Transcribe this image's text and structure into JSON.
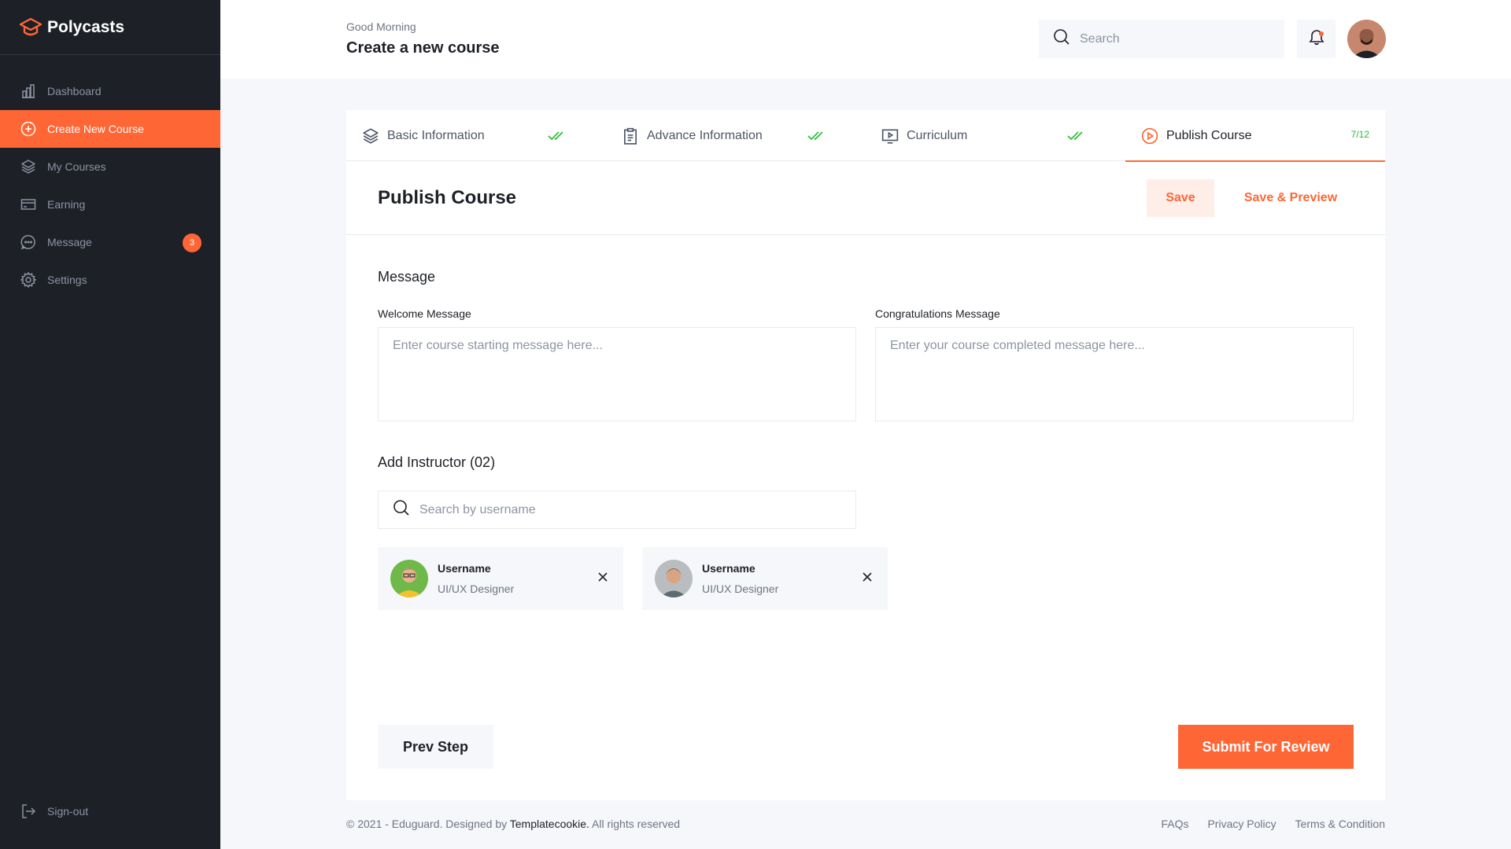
{
  "brand": {
    "name": "Polycasts",
    "accent": "#FF6636",
    "sidebar_bg": "#1D2026"
  },
  "sidebar": {
    "items": [
      {
        "label": "Dashboard",
        "icon": "bar-chart-icon"
      },
      {
        "label": "Create New Course",
        "icon": "plus-circle-icon",
        "active": true
      },
      {
        "label": "My Courses",
        "icon": "stack-icon"
      },
      {
        "label": "Earning",
        "icon": "credit-card-icon"
      },
      {
        "label": "Message",
        "icon": "chat-icon",
        "badge": "3"
      },
      {
        "label": "Settings",
        "icon": "gear-icon"
      }
    ],
    "signout": "Sign-out"
  },
  "header": {
    "greeting": "Good Morning",
    "title": "Create a new course",
    "search_placeholder": "Search"
  },
  "tabs": [
    {
      "label": "Basic Information",
      "icon": "stack-icon",
      "status": "done"
    },
    {
      "label": "Advance Information",
      "icon": "clipboard-icon",
      "status": "done"
    },
    {
      "label": "Curriculum",
      "icon": "monitor-play-icon",
      "status": "done"
    },
    {
      "label": "Publish Course",
      "icon": "play-circle-icon",
      "progress": "7/12",
      "active": true
    }
  ],
  "section": {
    "title": "Publish Course",
    "save": "Save",
    "save_preview": "Save & Preview"
  },
  "message": {
    "title": "Message",
    "welcome_label": "Welcome Message",
    "welcome_placeholder": "Enter course starting message here...",
    "congrats_label": "Congratulations Message",
    "congrats_placeholder": "Enter your course completed message here..."
  },
  "instructors": {
    "title": "Add Instructor (02)",
    "search_placeholder": "Search by username",
    "list": [
      {
        "name": "Username",
        "role": "UI/UX Designer"
      },
      {
        "name": "Username",
        "role": "UI/UX Designer"
      }
    ]
  },
  "actions": {
    "prev": "Prev Step",
    "submit": "Submit For Review"
  },
  "footer": {
    "copy_prefix": "© 2021 - Eduguard. Designed by ",
    "designer": "Templatecookie.",
    "copy_suffix": " All rights reserved",
    "links": [
      "FAQs",
      "Privacy Policy",
      "Terms & Condition"
    ]
  }
}
